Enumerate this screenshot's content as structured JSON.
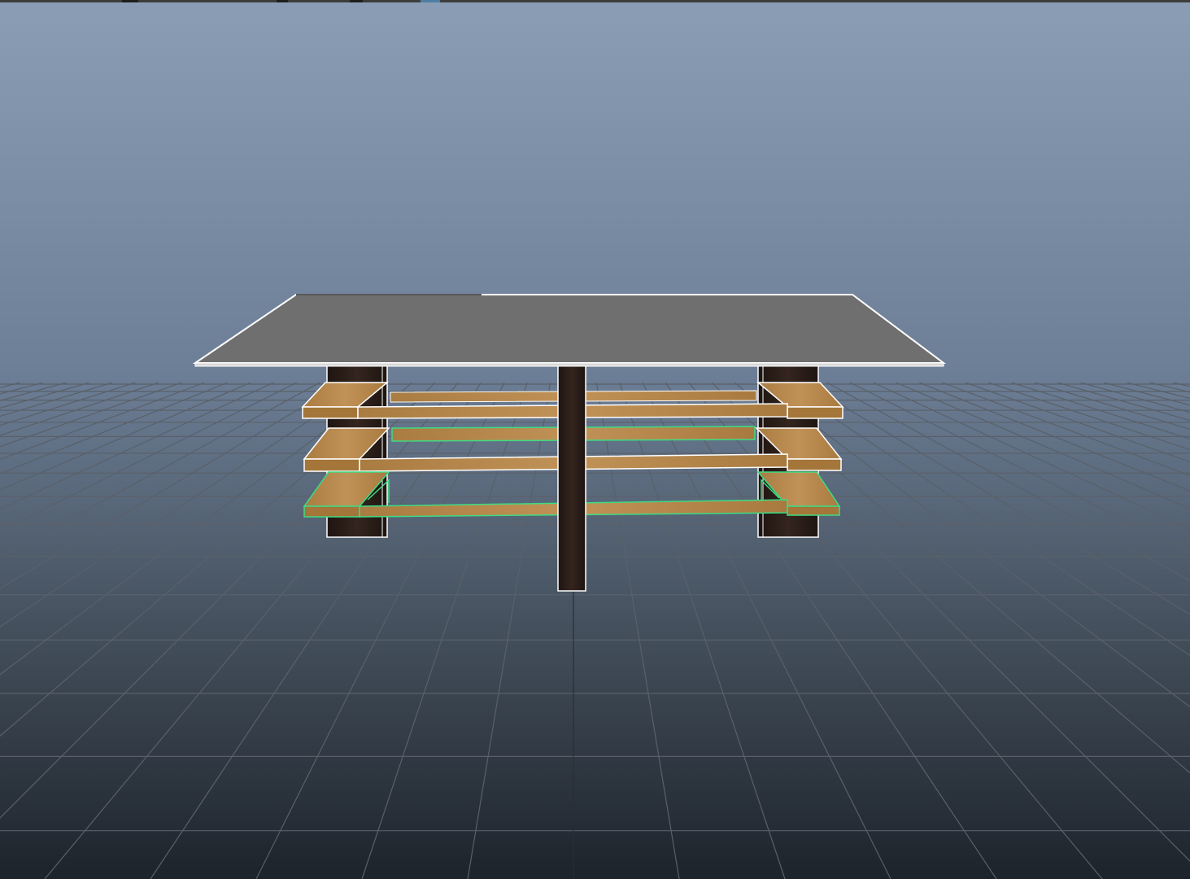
{
  "app": {
    "view": "3d-perspective-viewport"
  },
  "viewport": {
    "background_top": "#8a9db5",
    "background_bottom": "#1d232b",
    "grid_color": "#5a6069",
    "grid_axis_color": "#2b2e33"
  },
  "scene": {
    "objects": [
      {
        "name": "table-top",
        "color": "#6f6f6f",
        "outline": "#ffffff",
        "selected": false
      },
      {
        "name": "front-center-leg",
        "color": "#2a1d18",
        "selected": false
      },
      {
        "name": "left-legs",
        "color": "#2a1d18",
        "selected": false
      },
      {
        "name": "right-legs",
        "color": "#2a1d18",
        "selected": false
      },
      {
        "name": "shelf-upper",
        "color": "#b3874a",
        "outline": "#ffffff",
        "selected": false
      },
      {
        "name": "shelf-middle",
        "color": "#b3874a",
        "outline": "#ffffff",
        "selected": false
      },
      {
        "name": "shelf-lower",
        "color": "#b3874a",
        "outline": "#3ddc84",
        "selected": true
      }
    ],
    "selection_highlight_color": "#3ddc84"
  }
}
